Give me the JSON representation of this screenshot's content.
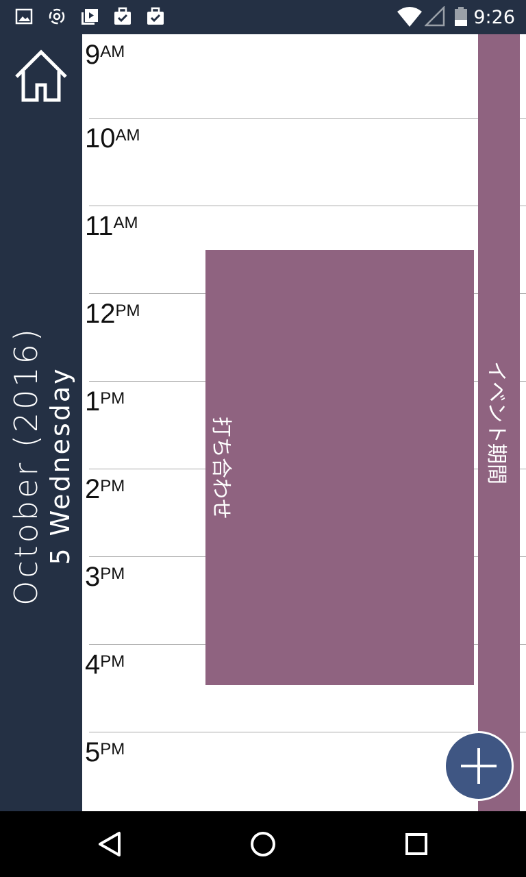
{
  "status_bar": {
    "time": "9:26",
    "left_icons": [
      "image-icon",
      "sync-icon",
      "video-library-icon",
      "task-check-icon",
      "task-check-icon"
    ],
    "right_icons": [
      "wifi-icon",
      "signal-icon",
      "battery-icon"
    ]
  },
  "sidebar": {
    "month_year": "October (2016)",
    "day": "5 Wednesday",
    "home_icon": "home-icon"
  },
  "timeline": {
    "hours": [
      {
        "num": "9",
        "suffix": "AM"
      },
      {
        "num": "10",
        "suffix": "AM"
      },
      {
        "num": "11",
        "suffix": "AM"
      },
      {
        "num": "12",
        "suffix": "PM"
      },
      {
        "num": "1",
        "suffix": "PM"
      },
      {
        "num": "2",
        "suffix": "PM"
      },
      {
        "num": "3",
        "suffix": "PM"
      },
      {
        "num": "4",
        "suffix": "PM"
      },
      {
        "num": "5",
        "suffix": "PM"
      }
    ]
  },
  "events": [
    {
      "title": "打ち合わせ"
    },
    {
      "title": "イベント期間"
    }
  ],
  "fab": {
    "icon": "plus-icon"
  },
  "nav_bar": {
    "icons": [
      "back-icon",
      "home-circle-icon",
      "recents-icon"
    ]
  },
  "colors": {
    "dark_navy": "#243044",
    "event_mauve": "#8f6380",
    "fab_blue": "#3f5683"
  }
}
